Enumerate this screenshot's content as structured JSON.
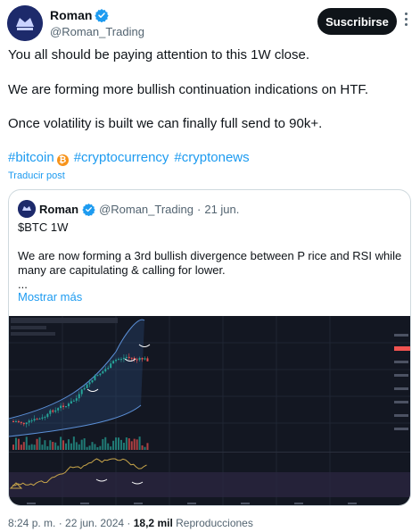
{
  "author": {
    "name": "Roman",
    "handle": "@Roman_Trading",
    "subscribe_label": "Suscribirse"
  },
  "post": {
    "lines": [
      "You all should be paying attention to this 1W close.",
      "We are forming more bullish continuation indications on HTF.",
      "Once volatility is built we can finally full send to 90k+."
    ],
    "hashtags": [
      "#bitcoin",
      "#cryptocurrency",
      "#cryptonews"
    ],
    "translate_label": "Traducir post"
  },
  "quoted": {
    "name": "Roman",
    "handle": "@Roman_Trading",
    "date": "21 jun.",
    "lines": [
      "$BTC 1W",
      "We are now forming a 3rd bullish divergence between P rice and RSI while",
      "many are capitulating & calling for lower.",
      "..."
    ],
    "show_more": "Mostrar más"
  },
  "meta": {
    "time": "8:24 p. m. · 22 jun. 2024 · ",
    "views": "18,2 mil",
    "views_label": " Reproducciones"
  },
  "colors": {
    "link": "#1d9bf0",
    "verified": "#1d9bf0",
    "chart_bg": "#131722",
    "bull": "#26a69a",
    "bear": "#ef5350"
  },
  "icons": [
    "verified-badge-icon",
    "more-icon",
    "bitcoin-icon"
  ]
}
